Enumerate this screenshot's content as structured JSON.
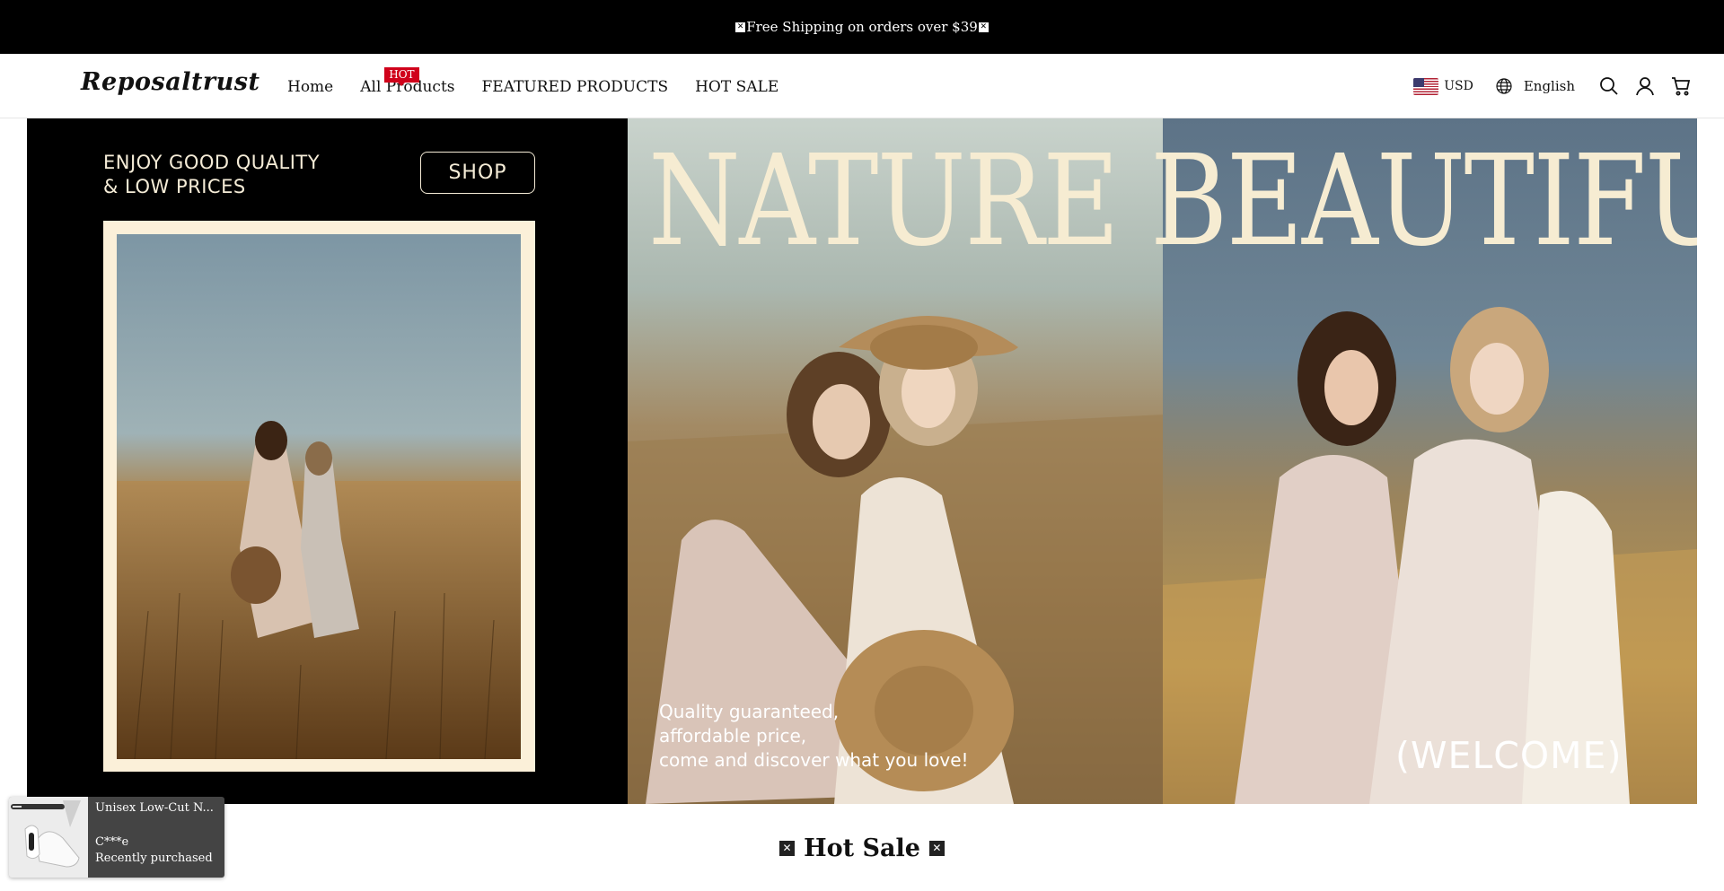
{
  "announcement": {
    "text": "Free Shipping on orders over $39",
    "mark_glyph": "✕"
  },
  "header": {
    "logo": "Reposaltrust",
    "nav": [
      {
        "label": "Home"
      },
      {
        "label": "All Products",
        "badge": "HOT"
      },
      {
        "label": "FEATURED PRODUCTS"
      },
      {
        "label": "HOT SALE"
      }
    ],
    "currency": "USD",
    "language": "English",
    "icons": [
      "globe-icon",
      "search-icon",
      "account-icon",
      "cart-icon"
    ]
  },
  "hero": {
    "tagline_line1": "ENJOY GOOD QUALITY",
    "tagline_line2": "& LOW PRICES",
    "shop_button": "SHOP",
    "title": "NATURE BEAUTIFUL.",
    "quality_line1": "Quality guaranteed,",
    "quality_line2": "affordable price,",
    "quality_line3": "come and discover what you love!",
    "welcome": "(WELCOME)"
  },
  "section": {
    "title": "Hot Sale",
    "mark_glyph": "✕"
  },
  "popup": {
    "product": "Unisex Low-Cut N...",
    "buyer": "C***e",
    "status": "Recently purchased"
  },
  "colors": {
    "announcement_bg": "#000000",
    "badge_red": "#d0021b",
    "hero_cream": "#f6ecd2"
  }
}
